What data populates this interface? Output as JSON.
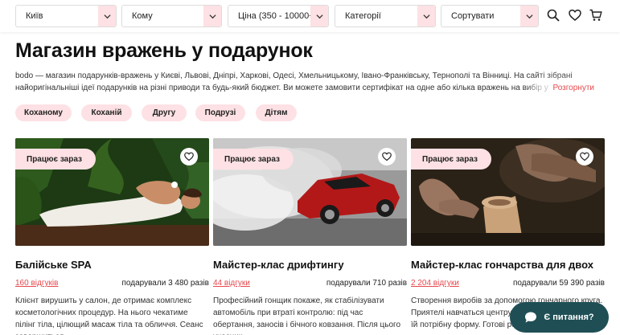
{
  "filters": {
    "city": "Київ",
    "recipient": "Кому",
    "price": "Ціна (350 - 10000+)",
    "category": "Категорії",
    "sort": "Сортувати"
  },
  "header_icons": [
    "search-icon",
    "heart-icon",
    "cart-icon"
  ],
  "page": {
    "title": "Магазин вражень у подарунок",
    "intro": "bodo — магазин подарунків-вражень у Києві, Львові, Дніпрі, Харкові, Одесі, Хмельницькому, Івано-Франківську, Тернополі та Вінниці. На сайті зібрані найоригінальніші ідеї подарунків на різні приводи та будь-який бюджет. Ви можете замовити сертифікат на одне або кілька вражень на вибір у категорії",
    "more": "Розгорнути"
  },
  "chips": [
    "Коханому",
    "Коханій",
    "Другу",
    "Подрузі",
    "Дітям"
  ],
  "cards": [
    {
      "badge": "Працює зараз",
      "name": "Балійське SPA",
      "reviews": "160 відгуків",
      "gifted": "подарували 3 480 разів",
      "desc": "Клієнт вирушить у салон, де отримає комплекс косметологічних процедур. На нього чекатиме пілінг тіла, цілющий масаж тіла та обличчя. Сеанс завершиться"
    },
    {
      "badge": "Працює зараз",
      "name": "Майстер-клас дрифтингу",
      "reviews": "44 відгуки",
      "gifted": "подарували 710 разів",
      "desc": "Професійний гонщик покаже, як стабілізувати автомобіль при втраті контролю: під час обертання, заносів і бічного ковзання. Після цього учасник"
    },
    {
      "badge": "Працює зараз",
      "name": "Майстер-клас гончарства для двох",
      "reviews": "2 204 відгуки",
      "gifted": "подарували 59 390 разів",
      "desc": "Створення виробів за допомогою гончарного круга. Приятелі навчаться центрувати глину та надавати їй потрібну форму. Готові роботи"
    }
  ],
  "chat": {
    "label": "Є питання?"
  },
  "colors": {
    "accent": "#e5484d",
    "pink": "#fde1e4",
    "chat": "#1f4f55"
  }
}
